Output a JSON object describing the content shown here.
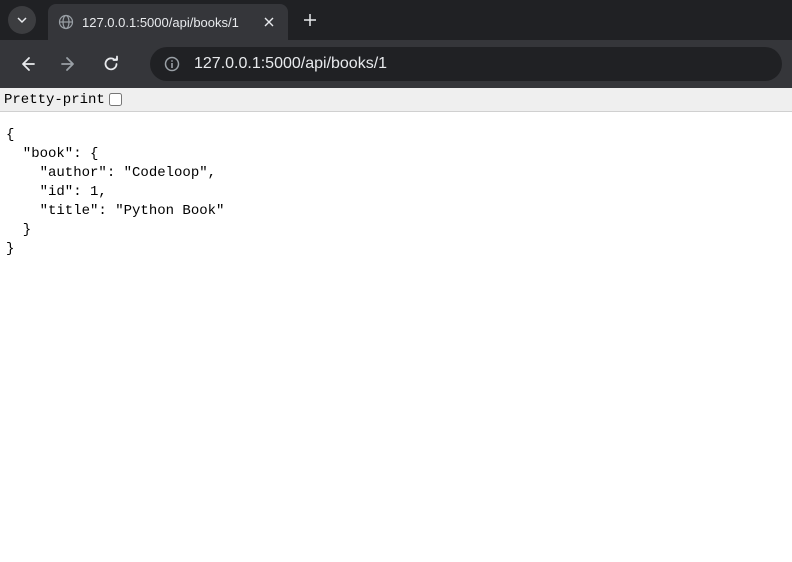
{
  "tab": {
    "title": "127.0.0.1:5000/api/books/1"
  },
  "address": {
    "url": "127.0.0.1:5000/api/books/1"
  },
  "pretty": {
    "label": "Pretty-print"
  },
  "body_text": "{\n  \"book\": {\n    \"author\": \"Codeloop\",\n    \"id\": 1,\n    \"title\": \"Python Book\"\n  }\n}"
}
